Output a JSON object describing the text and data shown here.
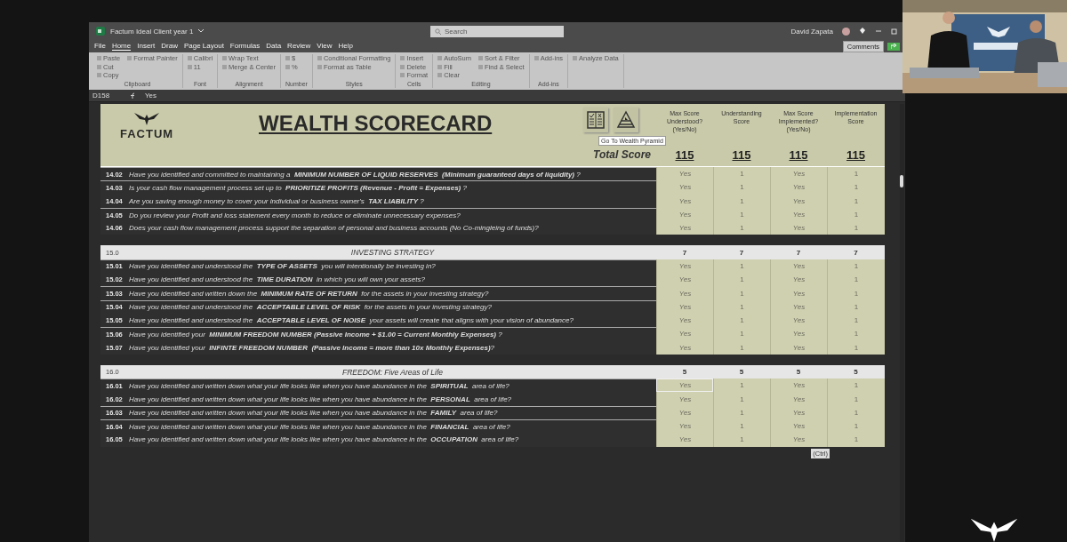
{
  "window": {
    "title": "Factum Ideal Client year 1",
    "search": {
      "placeholder": "Search"
    },
    "user": "David Zapata"
  },
  "menu_tabs": [
    {
      "label": "File",
      "selected": false
    },
    {
      "label": "Home",
      "selected": true
    },
    {
      "label": "Insert",
      "selected": false
    },
    {
      "label": "Draw",
      "selected": false
    },
    {
      "label": "Page Layout",
      "selected": false
    },
    {
      "label": "Formulas",
      "selected": false
    },
    {
      "label": "Data",
      "selected": false
    },
    {
      "label": "Review",
      "selected": false
    },
    {
      "label": "View",
      "selected": false
    },
    {
      "label": "Help",
      "selected": false
    }
  ],
  "comments_button": "Comments",
  "ribbon": [
    {
      "name": "Clipboard",
      "items": [
        "Paste",
        "Cut",
        "Copy",
        "Format Painter"
      ]
    },
    {
      "name": "Font",
      "items": [
        "Calibri",
        "11"
      ]
    },
    {
      "name": "Alignment",
      "items": [
        "Wrap Text",
        "Merge & Center"
      ]
    },
    {
      "name": "Number",
      "items": [
        "$",
        "%"
      ]
    },
    {
      "name": "Styles",
      "items": [
        "Conditional Formatting",
        "Format as Table"
      ]
    },
    {
      "name": "Cells",
      "items": [
        "Insert",
        "Delete",
        "Format"
      ]
    },
    {
      "name": "Editing",
      "items": [
        "AutoSum",
        "Fill",
        "Clear",
        "Sort & Filter",
        "Find & Select"
      ]
    },
    {
      "name": "Add-ins",
      "items": [
        "Add-ins"
      ]
    },
    {
      "items": [
        "Analyze Data"
      ]
    }
  ],
  "formula_bar": {
    "name_box": "D158",
    "value": "Yes"
  },
  "scorecard": {
    "logo": "FACTUM",
    "title": "WEALTH SCORECARD",
    "tooltip": "Go To Wealth Pyramid",
    "total_label": "Total Score",
    "columns": [
      "Max Score Understood? (Yes/No)",
      "Understanding Score",
      "Max Score Implemented? (Yes/No)",
      "Implementation Score"
    ],
    "totals": [
      "115",
      "115",
      "115",
      "115"
    ]
  },
  "sections": [
    {
      "groups": [
        [
          {
            "number": "14.02",
            "question": "Have you identified and committed to maintaining a  **MINIMUM NUMBER OF LIQUID RESERVES  (Minimum guaranteed days of liquidity)** ?",
            "answers": [
              "Yes",
              "1",
              "Yes",
              "1"
            ],
            "selected": false
          }
        ],
        [
          {
            "number": "14.03",
            "question": "Is your cash flow management process set up to  **PRIORITIZE PROFITS (Revenue - Profit = Expenses)** ?",
            "answers": [
              "Yes",
              "1",
              "Yes",
              "1"
            ],
            "selected": false
          },
          {
            "number": "14.04",
            "question": "Are you saving enough money to cover your individual or business owner's  **TAX LIABILITY** ?",
            "answers": [
              "Yes",
              "1",
              "Yes",
              "1"
            ],
            "selected": false
          }
        ],
        [
          {
            "number": "14.05",
            "question": "Do you review your Profit and loss statement every month to reduce or eliminate unnecessary expenses?",
            "answers": [
              "Yes",
              "1",
              "Yes",
              "1"
            ],
            "selected": false
          },
          {
            "number": "14.06",
            "question": "Does your cash flow management process support the separation of personal and business accounts (No Co-mingleing of funds)?",
            "answers": [
              "Yes",
              "1",
              "Yes",
              "1"
            ],
            "selected": false
          }
        ]
      ]
    },
    {
      "number": "15.0",
      "title": "INVESTING STRATEGY",
      "totals": [
        "7",
        "7",
        "7",
        "7"
      ],
      "groups": [
        [
          {
            "number": "15.01",
            "question": "Have you identified and understood the  **TYPE OF ASSETS**  you will intentionally be investing in?",
            "answers": [
              "Yes",
              "1",
              "Yes",
              "1"
            ],
            "selected": false
          },
          {
            "number": "15.02",
            "question": "Have you identified and understood the  **TIME DURATION**  in which you will own your assets?",
            "answers": [
              "Yes",
              "1",
              "Yes",
              "1"
            ],
            "selected": false
          }
        ],
        [
          {
            "number": "15.03",
            "question": "Have you identified and written down the  **MINIMUM RATE OF RETURN**  for the assets in your investing strategy?",
            "answers": [
              "Yes",
              "1",
              "Yes",
              "1"
            ],
            "selected": false
          }
        ],
        [
          {
            "number": "15.04",
            "question": "Have you identified and understood the  **ACCEPTABLE LEVEL OF RISK**  for the assets in your investing strategy?",
            "answers": [
              "Yes",
              "1",
              "Yes",
              "1"
            ],
            "selected": false
          },
          {
            "number": "15.05",
            "question": "Have you identified and understood the  **ACCEPTABLE LEVEL OF NOISE**  your assets will create that aligns with your vision of abundance?",
            "answers": [
              "Yes",
              "1",
              "Yes",
              "1"
            ],
            "selected": false
          }
        ],
        [
          {
            "number": "15.06",
            "question": "Have you identified your  **MINIMUM FREEDOM NUMBER (Passive Income + $1.00 = Current Monthly Expenses)** ?",
            "answers": [
              "Yes",
              "1",
              "Yes",
              "1"
            ],
            "selected": false
          },
          {
            "number": "15.07",
            "question": "Have you identified your  **INFINTE FREEDOM NUMBER  (Passive Income = more than 10x Monthly Expenses)**?",
            "answers": [
              "Yes",
              "1",
              "Yes",
              "1"
            ],
            "selected": false
          }
        ]
      ]
    },
    {
      "number": "16.0",
      "title": "FREEDOM: Five Areas of Life",
      "totals": [
        "5",
        "5",
        "5",
        "5"
      ],
      "groups": [
        [
          {
            "number": "16.01",
            "question": "Have you identified and written down what your life looks like when you have abundance in the  **SPIRITUAL**  area of life?",
            "answers": [
              "Yes",
              "1",
              "Yes",
              "1"
            ],
            "selected": true
          },
          {
            "number": "16.02",
            "question": "Have you identified and written down what your life looks like when you have abundance in the  **PERSONAL**  area of life?",
            "answers": [
              "Yes",
              "1",
              "Yes",
              "1"
            ],
            "selected": false
          }
        ],
        [
          {
            "number": "16.03",
            "question": "Have you identified and written down what your life looks like when you have abundance in the  **FAMILY**  area of life?",
            "answers": [
              "Yes",
              "1",
              "Yes",
              "1"
            ],
            "selected": false
          }
        ],
        [
          {
            "number": "16.04",
            "question": "Have you identified and written down what your life looks like when you have abundance in the  **FINANCIAL**  area of life?",
            "answers": [
              "Yes",
              "1",
              "Yes",
              "1"
            ],
            "selected": false
          },
          {
            "number": "16.05",
            "question": "Have you identified and written down what your life looks like when you have abundance in the  **OCCUPATION**  area of life?",
            "answers": [
              "Yes",
              "1",
              "Yes",
              "1"
            ],
            "selected": false
          }
        ]
      ]
    }
  ],
  "paste_options": "(Ctrl)"
}
